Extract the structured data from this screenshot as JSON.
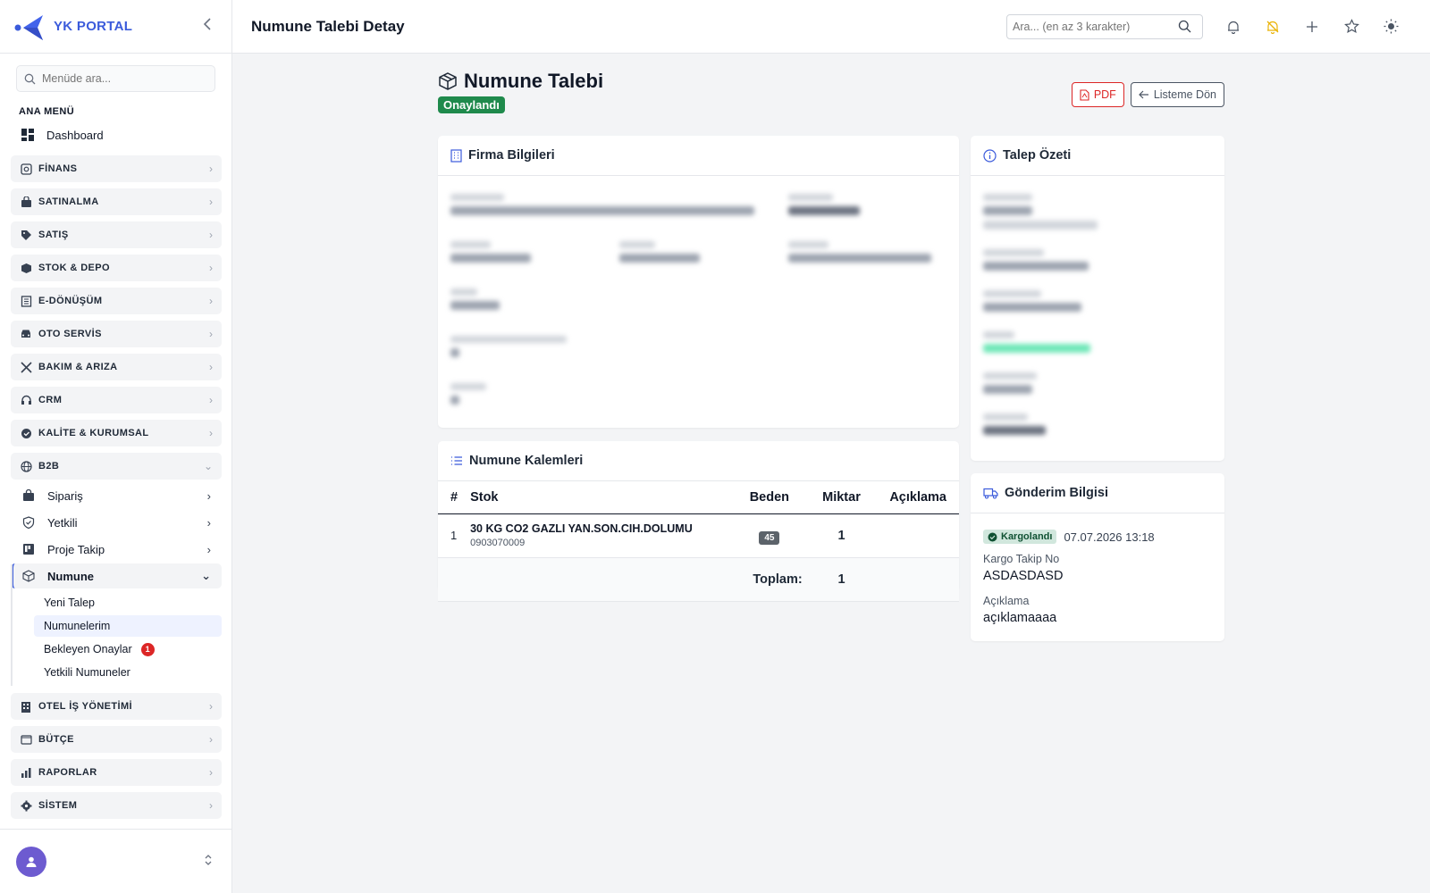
{
  "brand": {
    "name": "YK PORTAL"
  },
  "sidebar": {
    "search_placeholder": "Menüde ara...",
    "section_title": "ANA MENÜ",
    "dashboard_label": "Dashboard",
    "groups": [
      {
        "label": "FİNANS",
        "icon": "finance-icon"
      },
      {
        "label": "SATINALMA",
        "icon": "bag-icon"
      },
      {
        "label": "SATIŞ",
        "icon": "tag-icon"
      },
      {
        "label": "STOK & DEPO",
        "icon": "box-icon"
      },
      {
        "label": "E-DÖNÜŞÜM",
        "icon": "document-icon"
      },
      {
        "label": "OTO SERVİS",
        "icon": "car-icon"
      },
      {
        "label": "BAKIM & ARIZA",
        "icon": "tools-icon"
      },
      {
        "label": "CRM",
        "icon": "headset-icon"
      },
      {
        "label": "KALİTE & KURUMSAL",
        "icon": "badge-check-icon"
      },
      {
        "label": "B2B",
        "icon": "globe-icon"
      }
    ],
    "b2b_items": [
      {
        "label": "Sipariş",
        "icon": "shopping-bag-icon"
      },
      {
        "label": "Yetkili",
        "icon": "shield-icon"
      },
      {
        "label": "Proje Takip",
        "icon": "kanban-icon"
      },
      {
        "label": "Numune",
        "icon": "box-icon"
      }
    ],
    "numune_items": [
      {
        "label": "Yeni Talep"
      },
      {
        "label": "Numunelerim"
      },
      {
        "label": "Bekleyen Onaylar",
        "badge": "1"
      },
      {
        "label": "Yetkili Numuneler"
      }
    ],
    "groups_bottom": [
      {
        "label": "OTEL İŞ YÖNETİMİ",
        "icon": "building-icon"
      },
      {
        "label": "BÜTÇE",
        "icon": "wallet-icon"
      },
      {
        "label": "RAPORLAR",
        "icon": "bar-chart-icon"
      },
      {
        "label": "SİSTEM",
        "icon": "gear-icon"
      }
    ]
  },
  "topbar": {
    "title": "Numune Talebi Detay",
    "search_placeholder": "Ara... (en az 3 karakter)"
  },
  "page": {
    "title": "Numune Talebi",
    "status": "Onaylandı",
    "pdf_label": "PDF",
    "back_label": "Listeme Dön"
  },
  "firma": {
    "title": "Firma Bilgileri"
  },
  "ozet": {
    "title": "Talep Özeti"
  },
  "kalemler": {
    "title": "Numune Kalemleri",
    "columns": [
      "#",
      "Stok",
      "Beden",
      "Miktar",
      "Açıklama"
    ],
    "rows": [
      {
        "no": "1",
        "stok": "30 KG CO2 GAZLI YAN.SON.CIH.DOLUMU",
        "code": "0903070009",
        "beden": "45",
        "miktar": "1",
        "aciklama": ""
      }
    ],
    "total_label": "Toplam:",
    "total_value": "1"
  },
  "gonderim": {
    "title": "Gönderim Bilgisi",
    "status": "Kargolandı",
    "datetime": "07.07.2026 13:18",
    "tracking_label": "Kargo Takip No",
    "tracking_value": "ASDASDASD",
    "desc_label": "Açıklama",
    "desc_value": "açıklamaaaa"
  },
  "colors": {
    "brand": "#3b5bdb",
    "success": "#1f8a4c",
    "danger": "#dc2626"
  }
}
